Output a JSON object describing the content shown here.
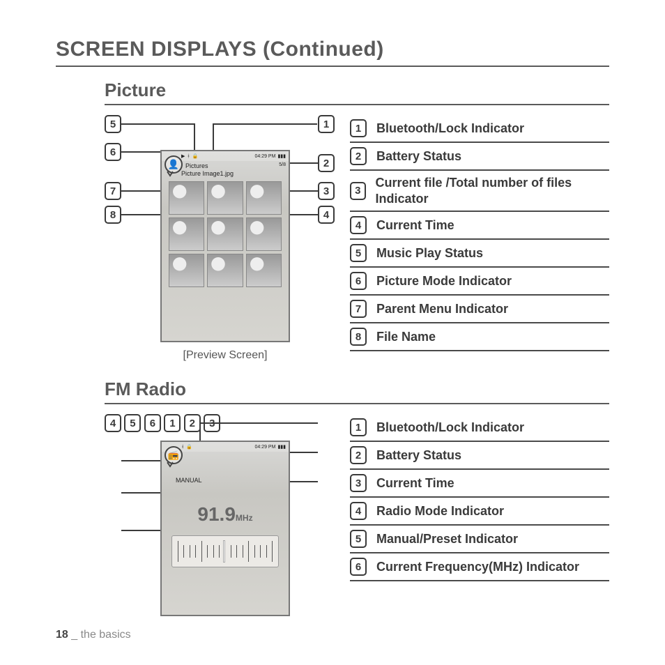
{
  "page": {
    "title": "SCREEN DISPLAYS (Continued)",
    "number": "18",
    "footer_label": "the basics"
  },
  "picture": {
    "heading": "Picture",
    "device": {
      "play_glyph": "▶",
      "bluetooth_glyph": "ᚼ",
      "lock_glyph": "🔒",
      "time": "04:29 PM",
      "battery_glyph": "▮▮▮",
      "parent_menu": "Pictures",
      "counter": "5/8",
      "file_name": "Picture Image1.jpg",
      "mode_glyph": "👤"
    },
    "caption": "[Preview Screen]",
    "callouts": {
      "left": [
        "5",
        "6",
        "7",
        "8"
      ],
      "right": [
        "1",
        "2",
        "3",
        "4"
      ]
    },
    "legend": [
      {
        "n": "1",
        "t": "Bluetooth/Lock Indicator"
      },
      {
        "n": "2",
        "t": "Battery Status"
      },
      {
        "n": "3",
        "t": "Current file /Total number of files Indicator"
      },
      {
        "n": "4",
        "t": "Current Time"
      },
      {
        "n": "5",
        "t": "Music Play Status"
      },
      {
        "n": "6",
        "t": "Picture Mode Indicator"
      },
      {
        "n": "7",
        "t": "Parent Menu Indicator"
      },
      {
        "n": "8",
        "t": "File Name"
      }
    ]
  },
  "fm": {
    "heading": "FM Radio",
    "device": {
      "bluetooth_glyph": "ᚼ",
      "lock_glyph": "🔒",
      "time": "04:29 PM",
      "battery_glyph": "▮▮▮",
      "mode_glyph": "📻",
      "manual_label": "MANUAL",
      "frequency": "91.9",
      "unit": "MHz"
    },
    "callouts": {
      "left": [
        "4",
        "5",
        "6"
      ],
      "right": [
        "1",
        "2",
        "3"
      ]
    },
    "legend": [
      {
        "n": "1",
        "t": "Bluetooth/Lock Indicator"
      },
      {
        "n": "2",
        "t": "Battery Status"
      },
      {
        "n": "3",
        "t": "Current Time"
      },
      {
        "n": "4",
        "t": "Radio Mode Indicator"
      },
      {
        "n": "5",
        "t": "Manual/Preset Indicator"
      },
      {
        "n": "6",
        "t": "Current Frequency(MHz) Indicator"
      }
    ]
  }
}
